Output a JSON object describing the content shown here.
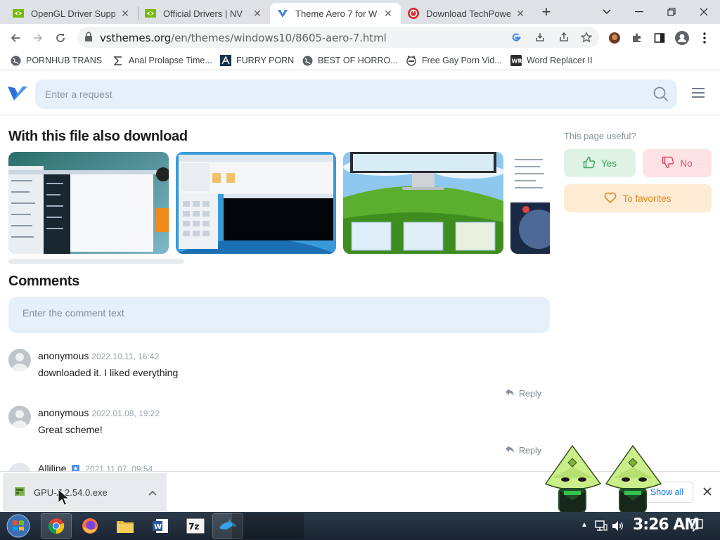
{
  "browser": {
    "tabs": [
      {
        "title": "OpenGL Driver Suppo",
        "active": false
      },
      {
        "title": "Official Drivers | NV",
        "active": false
      },
      {
        "title": "Theme Aero 7 for W",
        "active": true
      },
      {
        "title": "Download TechPower",
        "active": false
      }
    ],
    "new_tab": "+",
    "url_host": "vsthemes.org",
    "url_path": "/en/themes/windows10/8605-aero-7.html",
    "bookmarks": [
      {
        "label": "PORNHUB TRANS",
        "icon": "globe-icon"
      },
      {
        "label": "Anal Prolapse Time...",
        "icon": "sigma-icon"
      },
      {
        "label": "FURRY PORN",
        "icon": "a-logo-icon"
      },
      {
        "label": "BEST OF HORRO...",
        "icon": "globe-icon"
      },
      {
        "label": "Free Gay Porn Vid...",
        "icon": "raccoon-icon"
      },
      {
        "label": "Word Replacer II",
        "icon": "wr-icon"
      }
    ]
  },
  "site": {
    "search_placeholder": "Enter a request",
    "also_download_title": "With this file also download",
    "comments_title": "Comments",
    "comment_placeholder": "Enter the comment text",
    "useful_label": "This page useful?",
    "yes_label": "Yes",
    "no_label": "No",
    "favorites_label": "To favorites",
    "reply_label": "Reply",
    "comments": [
      {
        "author": "anonymous",
        "date": "2022.10.11, 16:42",
        "text": "downloaded it. I liked everything"
      },
      {
        "author": "anonymous",
        "date": "2022.01.08, 19:22",
        "text": "Great scheme!"
      },
      {
        "author": "Alliline",
        "date": "2021.11.07, 09:54",
        "text": ""
      }
    ]
  },
  "downloads": {
    "file_name": "GPU-Z.2.54.0.exe",
    "show_all": "Show all"
  },
  "taskbar": {
    "clock": "3:26 AM"
  },
  "colors": {
    "accent_blue": "#1a73e8",
    "site_input_bg": "#e6f0fb",
    "yes_green": "#3aa35c",
    "no_red": "#e04a5b",
    "favorite_orange": "#e08a1a"
  }
}
